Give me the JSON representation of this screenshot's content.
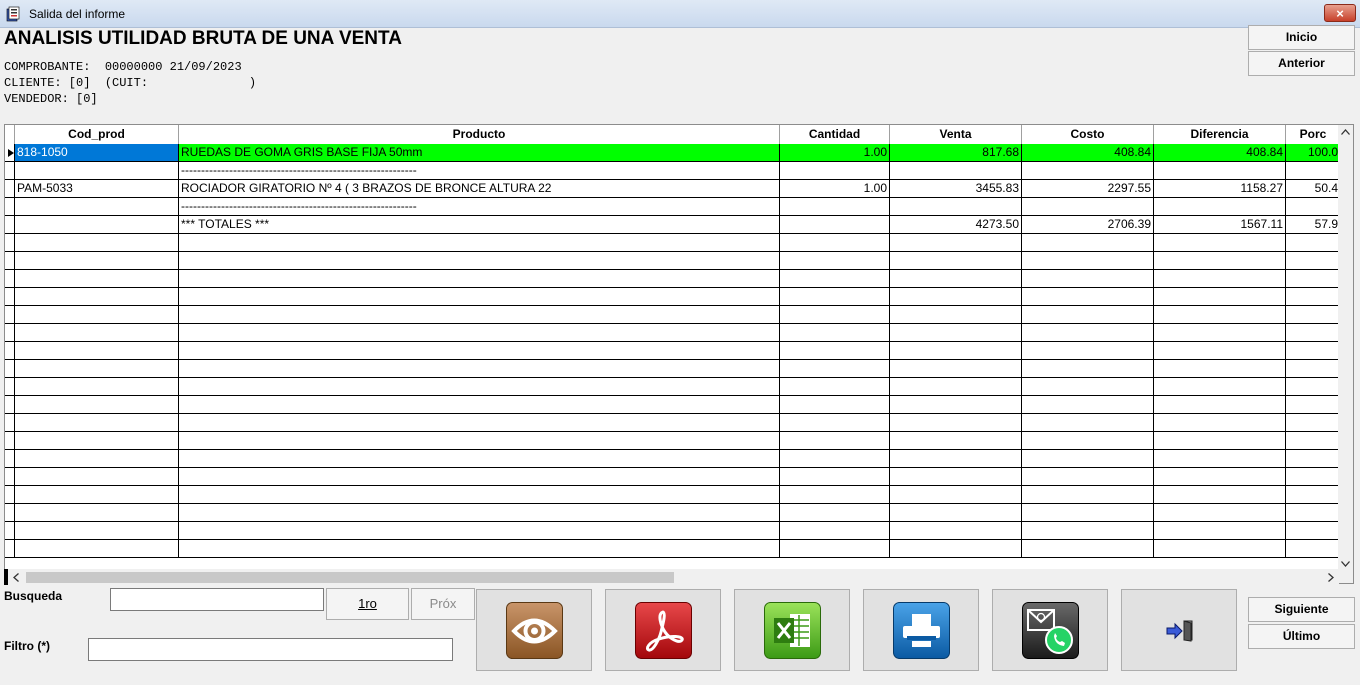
{
  "window": {
    "title": "Salida del informe",
    "close_label": "×"
  },
  "report": {
    "title": "ANALISIS UTILIDAD BRUTA DE UNA VENTA",
    "line1": "COMPROBANTE:  00000000 21/09/2023",
    "line2": "CLIENTE: [0]  (CUIT:              )",
    "line3": "VENDEDOR: [0]"
  },
  "nav": {
    "inicio": "Inicio",
    "anterior": "Anterior",
    "siguiente": "Siguiente",
    "ultimo": "Último"
  },
  "grid": {
    "columns": [
      "Cod_prod",
      "Producto",
      "Cantidad",
      "Venta",
      "Costo",
      "Diferencia",
      "Porc"
    ],
    "rows": [
      [
        "818-1050",
        "RUEDAS DE GOMA GRIS BASE FIJA 50mm",
        "1.00",
        "817.68",
        "408.84",
        "408.84",
        "100.0"
      ],
      [
        "",
        "-----------------------------------------------------------",
        "",
        "",
        "",
        "",
        ""
      ],
      [
        "PAM-5033",
        "ROCIADOR GIRATORIO Nº 4 ( 3 BRAZOS DE BRONCE ALTURA 22",
        "1.00",
        "3455.83",
        "2297.55",
        "1158.27",
        "50.4"
      ],
      [
        "",
        "-----------------------------------------------------------",
        "",
        "",
        "",
        "",
        ""
      ],
      [
        "",
        "*** TOTALES ***",
        "",
        "4273.50",
        "2706.39",
        "1567.11",
        "57.9"
      ]
    ],
    "selected_row": 0,
    "selected_color": "#00ff00",
    "code_highlight_color": "#0078d7"
  },
  "search": {
    "busqueda_label": "Busqueda",
    "busqueda_value": "",
    "first_label": "1ro",
    "next_label": "Próx",
    "filtro_label": "Filtro (*)",
    "filtro_value": ""
  },
  "actions": [
    {
      "name": "view",
      "icon": "eye-icon"
    },
    {
      "name": "pdf",
      "icon": "pdf-icon"
    },
    {
      "name": "excel",
      "icon": "excel-icon"
    },
    {
      "name": "print",
      "icon": "printer-icon"
    },
    {
      "name": "send",
      "icon": "email-whatsapp-icon"
    },
    {
      "name": "exit",
      "icon": "exit-door-icon"
    }
  ]
}
